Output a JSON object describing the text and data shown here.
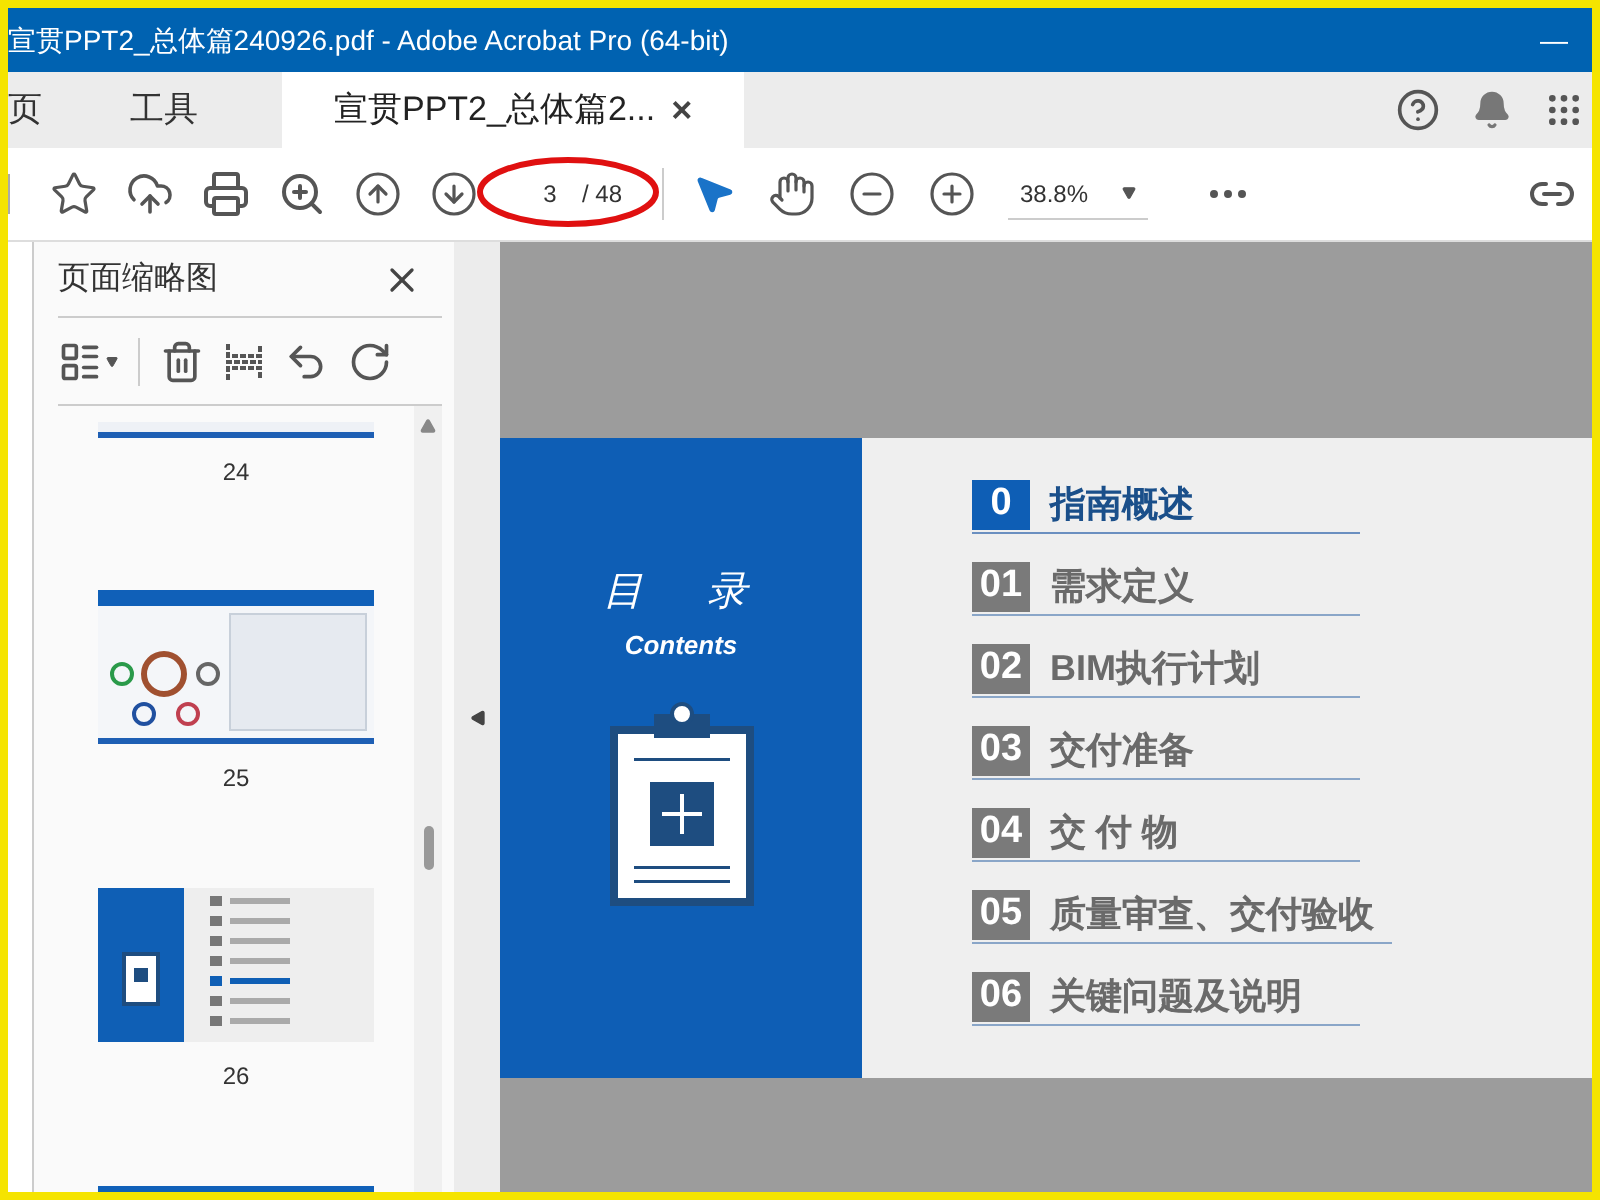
{
  "window": {
    "title": "宣贯PPT2_总体篇240926.pdf - Adobe Acrobat Pro (64-bit)",
    "minimize": "—"
  },
  "tabs": [
    {
      "label": "页",
      "selected": false
    },
    {
      "label": "工具",
      "selected": false
    },
    {
      "label": "宣贯PPT2_总体篇2...",
      "selected": true,
      "close": "×"
    }
  ],
  "toolbar": {
    "page_current": "3",
    "page_total": "/ 48",
    "zoom": "38.8%",
    "page_field_circled": true
  },
  "sidebar": {
    "title": "页面缩略图",
    "thumbnails": [
      {
        "kind": "partial",
        "label": "24"
      },
      {
        "kind": "diagram",
        "label": "25"
      },
      {
        "kind": "contents",
        "label": "26"
      },
      {
        "kind": "cut"
      }
    ]
  },
  "slide": {
    "title": "目　录",
    "subtitle": "Contents",
    "items": [
      {
        "number": "0",
        "label": "指南概述",
        "selected": true
      },
      {
        "number": "01",
        "label": "需求定义",
        "selected": false
      },
      {
        "number": "02",
        "label": "BIM执行计划",
        "selected": false
      },
      {
        "number": "03",
        "label": "交付准备",
        "selected": false
      },
      {
        "number": "04",
        "label": "交 付 物",
        "selected": false
      },
      {
        "number": "05",
        "label": "质量审查、交付验收",
        "selected": false
      },
      {
        "number": "06",
        "label": "关键问题及说明",
        "selected": false
      }
    ]
  }
}
